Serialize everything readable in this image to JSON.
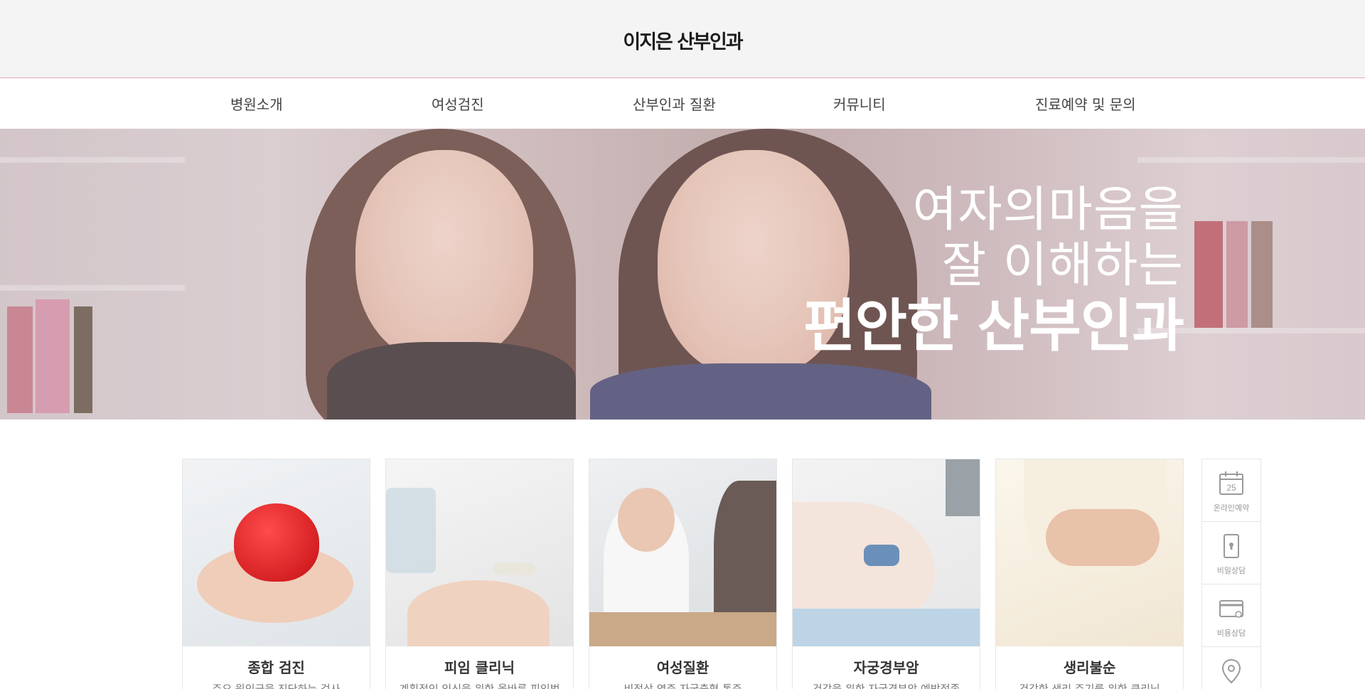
{
  "header": {
    "logo": "이지은 산부인과"
  },
  "nav": {
    "items": [
      "병원소개",
      "여성검진",
      "산부인과 질환",
      "커뮤니티",
      "진료예약 및 문의"
    ]
  },
  "hero": {
    "line1": "여자의마음을",
    "line2": "잘 이해하는",
    "line3": "편안한 산부인과"
  },
  "cards": [
    {
      "title": "종합 검진",
      "desc": "주요 원인균을 진단하는 검사"
    },
    {
      "title": "피임 클리닉",
      "desc": "계획적인 임신을 위한 올바른 피임법"
    },
    {
      "title": "여성질환",
      "desc": "비정상 염증 자궁출혈 통증"
    },
    {
      "title": "자궁경부암",
      "desc": "건강을 위한 자궁경부암 예방접종"
    },
    {
      "title": "생리불순",
      "desc": "건강한 생리 주기를 위한 클리닉"
    }
  ],
  "quick_menu": {
    "items": [
      {
        "label": "온라인예약",
        "icon": "calendar-icon",
        "day": "25"
      },
      {
        "label": "비밀상담",
        "icon": "lock-phone-icon"
      },
      {
        "label": "비용상담",
        "icon": "card-icon"
      },
      {
        "label": "",
        "icon": "location-pin-icon"
      }
    ]
  },
  "colors": {
    "accent": "#e7a6bd",
    "header_bg": "#f4f4f4",
    "hero_text": "#ffffff"
  }
}
